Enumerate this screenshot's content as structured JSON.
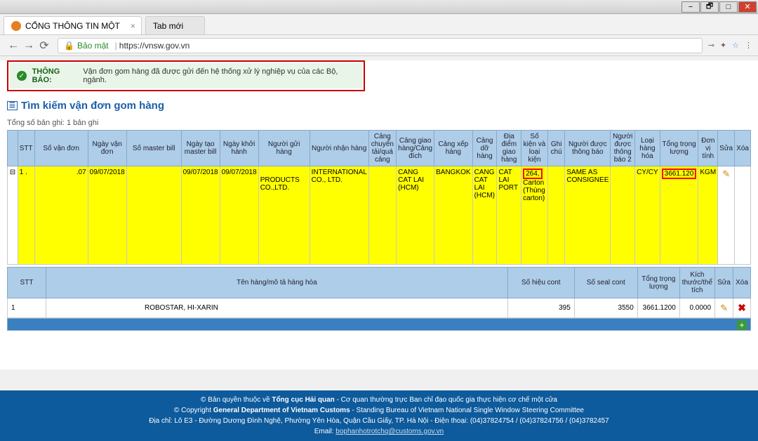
{
  "window": {
    "btns": {
      "min": "−",
      "max1": "🗗",
      "max2": "□",
      "close": "✕"
    }
  },
  "browser": {
    "tabs": [
      {
        "title": "CỔNG THÔNG TIN MỘT",
        "active": true,
        "favicon": "orange"
      },
      {
        "title": "Tab mới",
        "active": false,
        "favicon": ""
      }
    ],
    "nav": {
      "back": "←",
      "fwd": "→",
      "reload": "⟳"
    },
    "lock_label": "Bảo mật",
    "url_prefix": "https://",
    "url_domain": "vnsw.gov.vn",
    "right_icons": {
      "key": "⊸",
      "ext": "✦",
      "star": "☆",
      "menu": "⋮"
    }
  },
  "alert": {
    "title": "THÔNG BÁO:",
    "msg": "Vận đơn gom hàng đã được gửi đến hệ thống xử lý nghiệp vụ của các Bộ, ngành."
  },
  "page": {
    "title_icon": "☰",
    "title": "Tìm kiếm vận đơn gom hàng",
    "record_count": "Tổng số bản ghi: 1 bản ghi"
  },
  "columns": {
    "expand": "",
    "stt": "STT",
    "svd": "Số vận đơn",
    "nvd": "Ngày vận đơn",
    "smb": "Số master bill",
    "ntmb": "Ngày tạo master bill",
    "nkh": "Ngày khởi hành",
    "ngh": "Người gửi hàng",
    "nnh": "Người nhận hàng",
    "cctqc": "Cảng chuyển tải/quá cảng",
    "cghcd": "Cảng giao hàng/Cảng đích",
    "cxh": "Cảng xếp hàng",
    "cdh": "Cảng dỡ hàng",
    "ddgh": "Địa điểm giao hàng",
    "skvlk": "Số kiện và loại kiện",
    "gc": "Ghi chú",
    "ndtb": "Người được thông báo",
    "ndtb2": "Người được thông báo 2",
    "lhh": "Loại hàng hóa",
    "ttl": "Tổng trọng lượng",
    "dvt": "Đơn vị tính",
    "sua": "Sửa",
    "xoa": "Xóa"
  },
  "row": {
    "stt": "1 .",
    "svd_suffix": ".07",
    "nvd": "09/07/2018",
    "ntmb": "09/07/2018",
    "nkh": "09/07/2018",
    "ngh": "PRODUCTS CO.,LTD.",
    "nnh": "INTERNATIONAL CO., LTD.",
    "cghcd": "CANG CAT LAI (HCM)",
    "cxh": "BANGKOK",
    "cdh": "CANG CAT LAI (HCM)",
    "ddgh": "CAT LAI PORT",
    "skvlk": "264, Carton (Thùng carton)",
    "skvlk_red": "264,",
    "skvlk_rest": "Carton (Thùng carton)",
    "ndtb": "SAME AS CONSIGNEE",
    "lhh": "CY/CY",
    "ttl": "3661.120",
    "dvt": "KGM"
  },
  "sub_columns": {
    "stt": "STT",
    "ten": "Tên hàng/mô tả hàng hóa",
    "shc": "Số hiệu cont",
    "ssc": "Số seal cont",
    "ttl": "Tổng trọng lượng",
    "ktt": "Kích thước/thể tích",
    "sua": "Sửa",
    "xoa": "Xóa"
  },
  "sub_row": {
    "stt": "1",
    "ten": "ROBOSTAR, HI-XARIN",
    "shc": "395",
    "ssc": "3550",
    "ttl": "3661.1200",
    "ktt": "0.0000"
  },
  "footer": {
    "l1a": "© Bản quyền thuộc về ",
    "l1b": "Tổng cục Hải quan",
    "l1c": " - Cơ quan thường trực Ban chỉ đạo quốc gia thực hiện cơ chế một cửa",
    "l2a": "© Copyright ",
    "l2b": "General Department of Vietnam Customs",
    "l2c": " - Standing Bureau of Vietnam National Single Window Steering Committee",
    "l3": "Địa chỉ: Lô E3 - Đường Dương Đình Nghệ, Phường Yên Hòa, Quận Cầu Giấy, TP. Hà Nội - Điện thoại: (04)37824754 / (04)37824756 / (04)3782457",
    "l4a": "Email: ",
    "l4b": "bophanhotrotchq@customs.gov.vn"
  }
}
